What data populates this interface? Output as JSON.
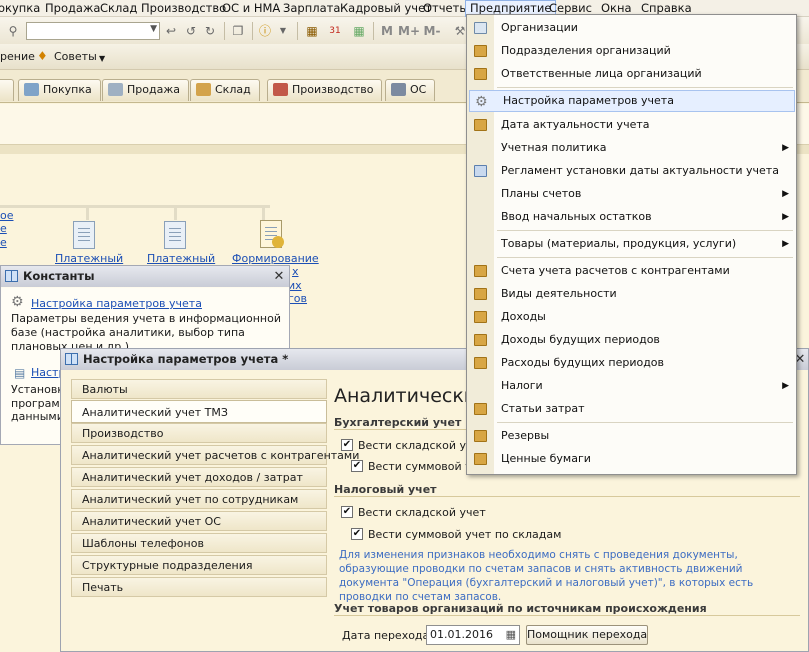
{
  "menubar": {
    "items": [
      "окупка",
      "Продажа",
      "Склад",
      "Производство",
      "ОС и НМА",
      "Зарплата",
      "Кадровый учет",
      "Отчеты",
      "Предприятие",
      "Сервис",
      "Окна",
      "Справка"
    ],
    "active": "Предприятие"
  },
  "toolbar": {
    "left_fragment": "рение",
    "advice_label": "Советы",
    "m_labels": [
      "M",
      "M+",
      "M-"
    ]
  },
  "section_tabs": [
    "Покупка",
    "Продажа",
    "Склад",
    "Производство",
    "ОС"
  ],
  "desktop": {
    "left_links": [
      "ое",
      "е",
      "е"
    ],
    "docs": [
      "Платежный",
      "Платежный",
      "Формирование"
    ],
    "right_fragments": [
      "х",
      "их",
      "гов"
    ]
  },
  "constants_window": {
    "title": "Константы",
    "link": "Настройка параметров учета",
    "description": "Параметры ведения учета в информационной базе (настройка аналитики, выбор типа плановых цен и др.)",
    "link2": "Настр",
    "desc2": [
      "Установк",
      "программ",
      "данными."
    ]
  },
  "settings_window": {
    "title": "Настройка параметров учета *",
    "nav": [
      "Валюты",
      "Аналитический учет ТМЗ",
      "Производство",
      "Аналитический учет расчетов с контрагентами",
      "Аналитический учет доходов / затрат",
      "Аналитический учет по сотрудникам",
      "Аналитический учет ОС",
      "Шаблоны телефонов",
      "Структурные подразделения",
      "Печать"
    ],
    "selected_nav": "Аналитический учет ТМЗ",
    "heading": "Аналитически",
    "groups": {
      "buh": "Бухгалтерский учет",
      "nal": "Налоговый учет",
      "origin": "Учет товаров организаций по источникам происхождения"
    },
    "checks": {
      "buh_sklad": "Вести складской учет",
      "buh_sum": "Вести суммовой уче",
      "nal_sklad": "Вести складской учет",
      "nal_sum": "Вести суммовой учет по складам"
    },
    "hint": "Для изменения признаков необходимо снять с проведения документы, образующие проводки по счетам запасов и снять активность движений документа \"Операция (бухгалтерский и налоговый учет)\", в которых есть проводки по счетам запасов.",
    "date_label": "Дата перехода:",
    "date_value": "01.01.2016",
    "wizard_button": "Помощник перехода"
  },
  "dropdown": {
    "items": [
      {
        "label": "Организации",
        "icon": "building-icon",
        "submenu": false
      },
      {
        "label": "Подразделения организаций",
        "icon": "folder-icon",
        "submenu": false
      },
      {
        "label": "Ответственные лица организаций",
        "icon": "folder-icon",
        "submenu": false
      },
      {
        "label": "Настройка параметров учета",
        "icon": "gear-icon",
        "submenu": false,
        "highlighted": true
      },
      {
        "label": "Дата актуальности учета",
        "icon": "folder-icon",
        "submenu": false
      },
      {
        "label": "Учетная политика",
        "icon": "",
        "submenu": true
      },
      {
        "label": "Регламент установки даты актуальности учета",
        "icon": "regulation-icon",
        "submenu": false
      },
      {
        "label": "Планы счетов",
        "icon": "",
        "submenu": true
      },
      {
        "label": "Ввод начальных остатков",
        "icon": "",
        "submenu": true
      },
      {
        "label": "Товары (материалы, продукция, услуги)",
        "icon": "",
        "submenu": true
      },
      {
        "label": "Счета учета расчетов с контрагентами",
        "icon": "folder-icon",
        "submenu": false
      },
      {
        "label": "Виды деятельности",
        "icon": "folder-icon",
        "submenu": false
      },
      {
        "label": "Доходы",
        "icon": "folder-icon",
        "submenu": false
      },
      {
        "label": "Доходы будущих периодов",
        "icon": "folder-icon",
        "submenu": false
      },
      {
        "label": "Расходы будущих периодов",
        "icon": "folder-icon",
        "submenu": false
      },
      {
        "label": "Налоги",
        "icon": "",
        "submenu": true
      },
      {
        "label": "Статьи затрат",
        "icon": "folder-icon",
        "submenu": false
      },
      {
        "label": "Резервы",
        "icon": "folder-icon",
        "submenu": false
      },
      {
        "label": "Ценные бумаги",
        "icon": "folder-icon",
        "submenu": false
      }
    ]
  },
  "colors": {
    "background": "#fbf4dc",
    "link": "#1c4fb5",
    "hint": "#3c6cc2",
    "menu_highlight": "#e6efff"
  }
}
